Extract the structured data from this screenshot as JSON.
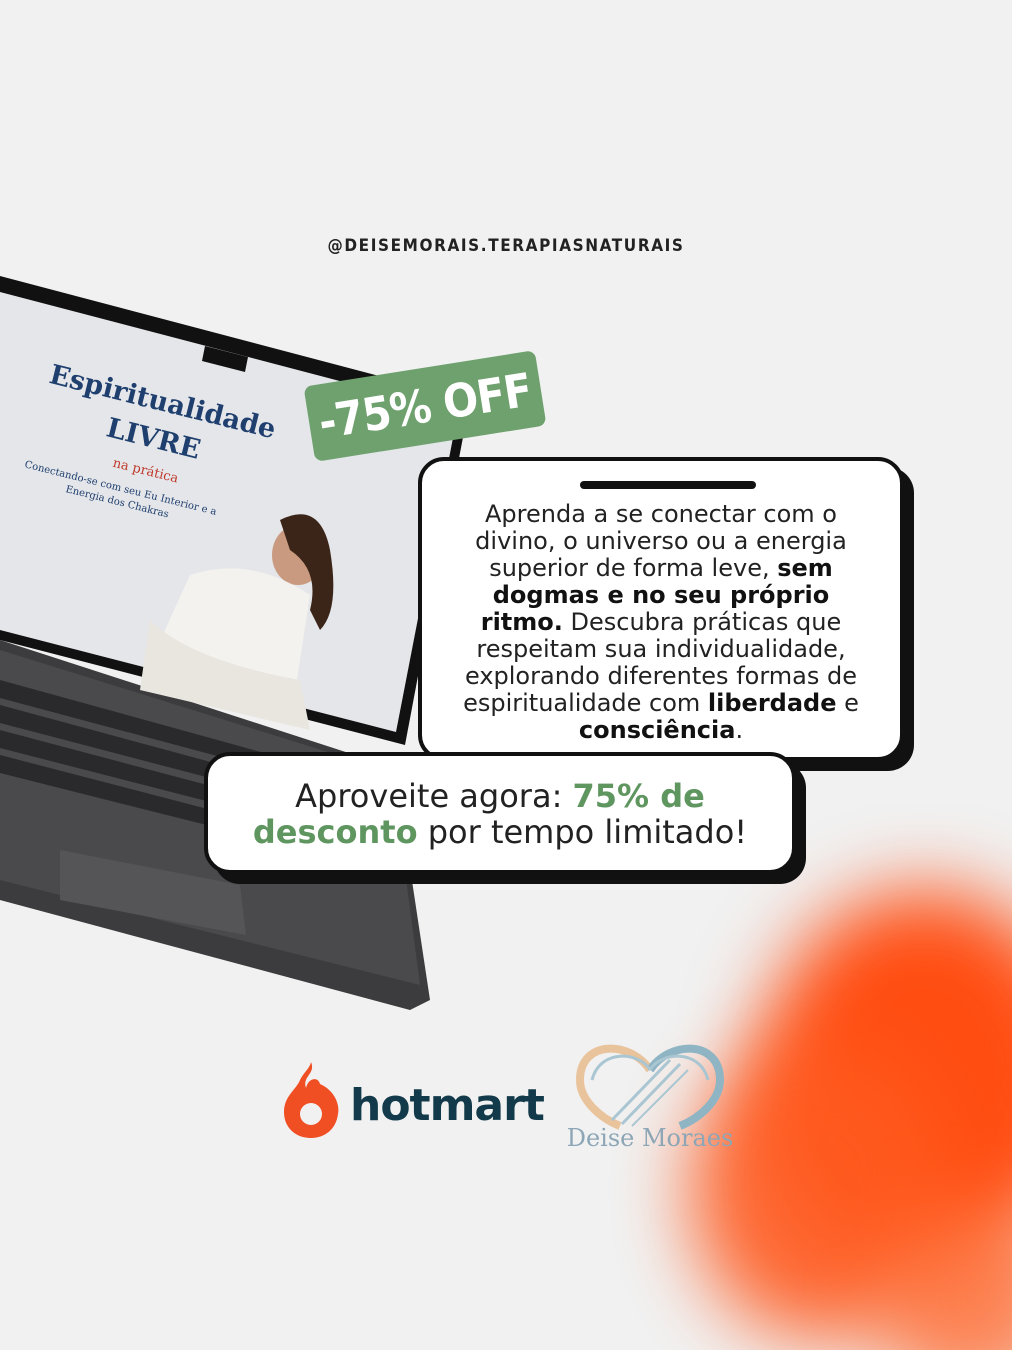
{
  "handle": "@DEISEMORAIS.TERAPIASNATURAIS",
  "screen": {
    "title_line1": "Espiritualidade",
    "title_line2": "LIVRE",
    "subtitle": "na prática",
    "description": "Conectando-se com seu Eu Interior e a Energia dos Chakras"
  },
  "badge": "-75% OFF",
  "card": {
    "p1": "Aprenda a se conectar com o divino, o universo ou a energia superior de forma leve, ",
    "p1_bold": "sem dogmas e no seu próprio ritmo.",
    "p2": " Descubra práticas que respeitam sua individualidade, explorando diferentes formas de espiritualidade com ",
    "p2_bold1": "liberdade",
    "p2_mid": " e ",
    "p2_bold2": "consciência",
    "p2_end": "."
  },
  "cta": {
    "t1": "Aproveite agora: ",
    "accent1": "75% de desconto",
    "t2": " por tempo limitado!"
  },
  "logos": {
    "hotmart": "hotmart",
    "deise": "Deise Moraes"
  },
  "colors": {
    "background": "#f1f1f1",
    "accent_green": "#6fa16f",
    "hotmart_orange": "#f04e23",
    "blob_orange": "#ff4d12"
  }
}
